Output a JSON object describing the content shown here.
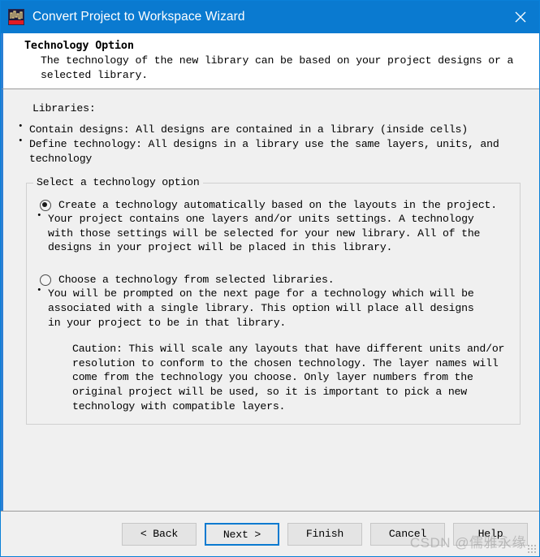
{
  "window": {
    "title": "Convert Project to Workspace Wizard",
    "app_icon": "waveform-icon",
    "close_icon": "close-icon",
    "titlebar_color": "#0a7ad0",
    "accent_color": "#2b7fd4",
    "body_color": "#f0f0f0"
  },
  "header": {
    "title": "Technology Option",
    "subtitle": "The technology of the new library can be based on your project designs or a selected library."
  },
  "main": {
    "libraries_label": "Libraries:",
    "library_bullets": [
      "Contain designs: All designs are contained in a library (inside cells)",
      "Define technology: All designs in a library use the same layers, units, and technology"
    ],
    "group": {
      "legend": "Select a technology option",
      "options": [
        {
          "label": "Create a technology automatically based on the layouts in the project.",
          "selected": true,
          "bullets": [
            "Your project contains one layers and/or units settings. A technology with those settings will be selected for your new library. All of the designs in your project will be placed in this library."
          ],
          "caution": ""
        },
        {
          "label": "Choose a technology from selected libraries.",
          "selected": false,
          "bullets": [
            "You will be prompted on the next page for a technology which will be associated with a single library. This option will place all designs in your project to be in that library."
          ],
          "caution": "Caution: This will scale any layouts that have different units and/or resolution to conform to the chosen technology. The layer names will come from the technology you choose. Only layer numbers from the original project will be used, so it is important to pick a new technology with compatible layers."
        }
      ]
    }
  },
  "footer": {
    "buttons": [
      {
        "label": "< Back",
        "name": "back-button",
        "default": false
      },
      {
        "label": "Next >",
        "name": "next-button",
        "default": true
      },
      {
        "label": "Finish",
        "name": "finish-button",
        "default": false
      },
      {
        "label": "Cancel",
        "name": "cancel-button",
        "default": false
      },
      {
        "label": "Help",
        "name": "help-button",
        "default": false
      }
    ]
  },
  "watermark": {
    "text": "CSDN @儒雅永缘"
  }
}
